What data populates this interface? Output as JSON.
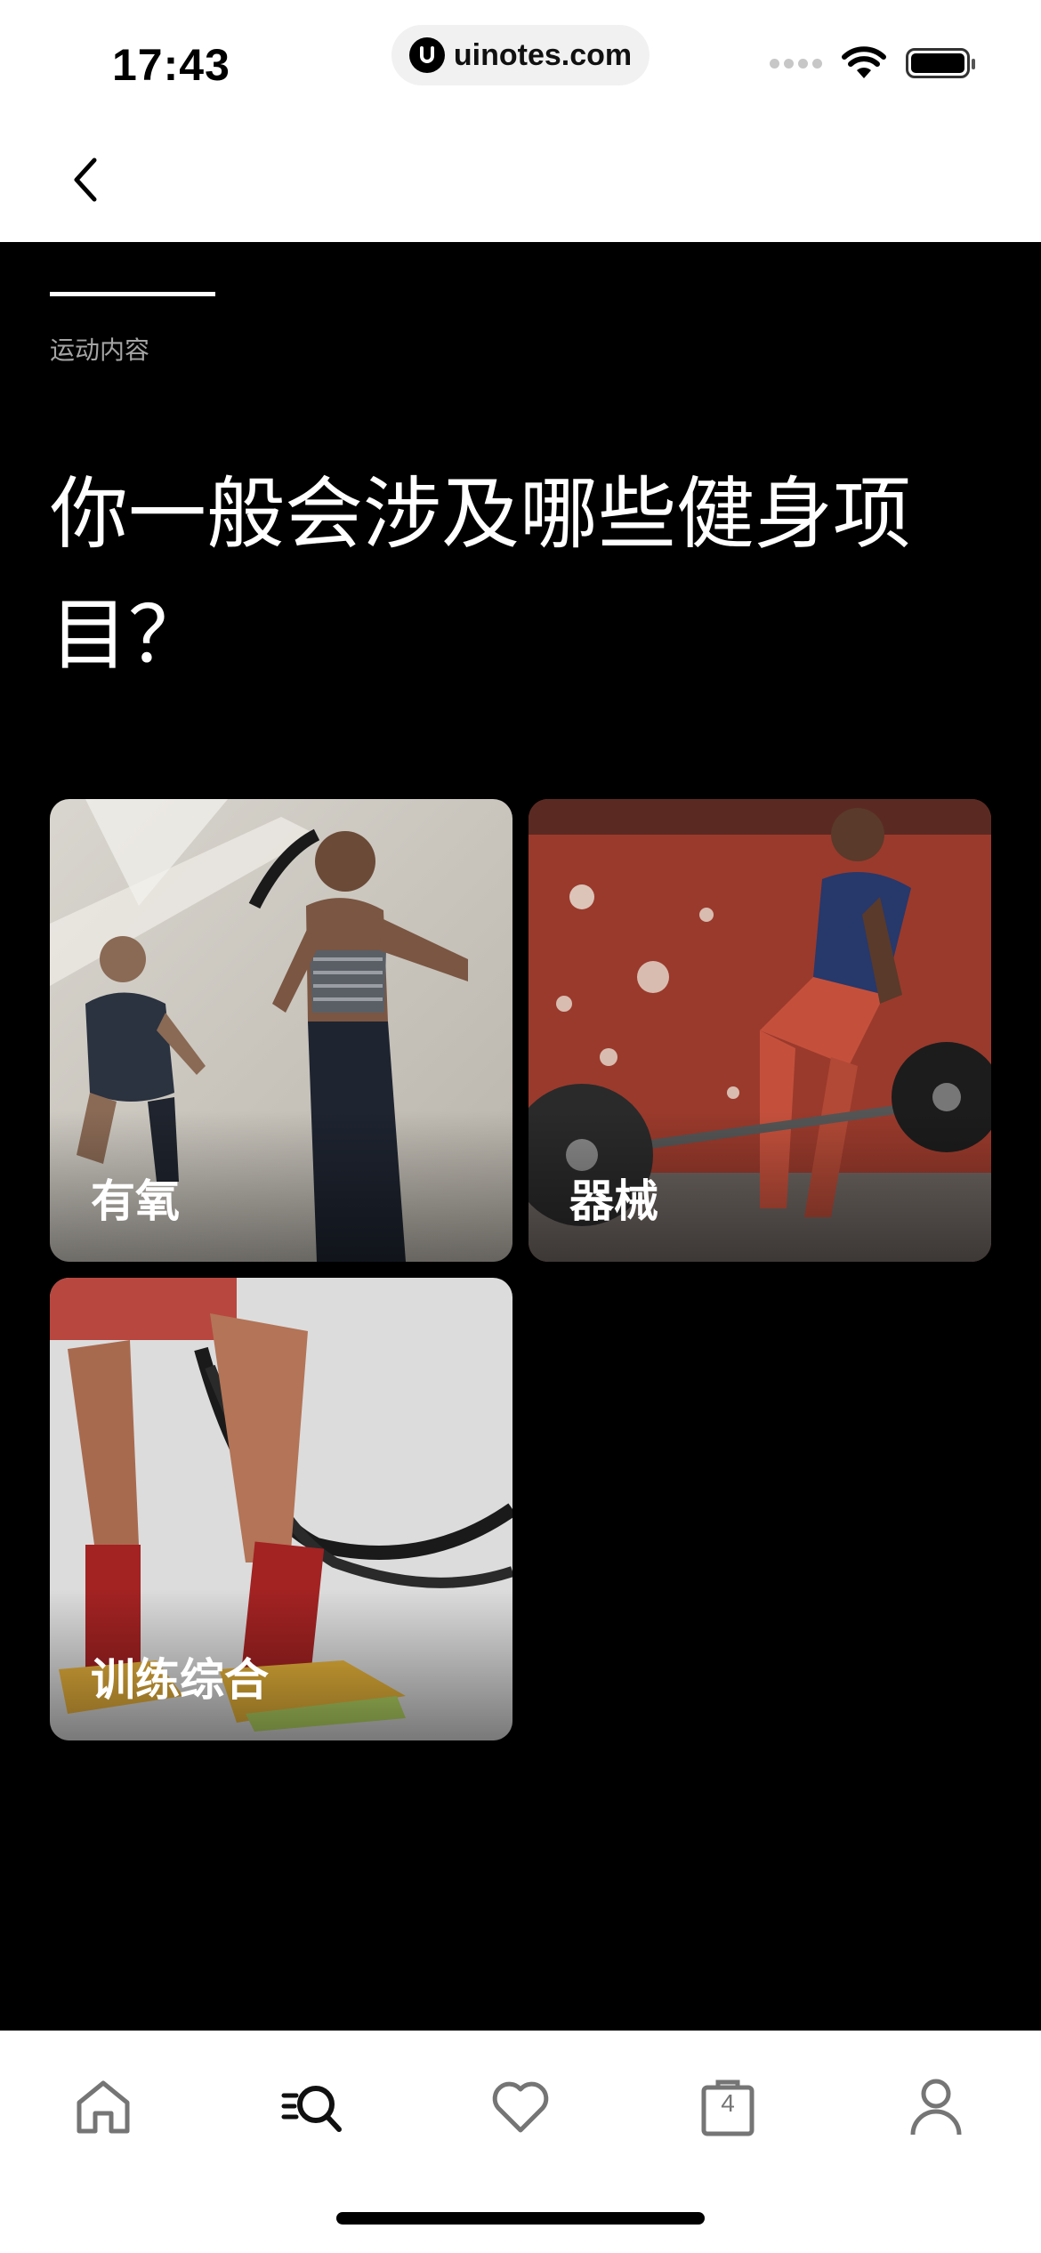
{
  "status_bar": {
    "time": "17:43",
    "url": "uinotes.com"
  },
  "nav": {
    "back_icon": "chevron-left-icon"
  },
  "survey": {
    "section_label": "运动内容",
    "question": "你一般会涉及哪些健身项目？",
    "options": [
      {
        "label": "有氧"
      },
      {
        "label": "器械"
      },
      {
        "label": "训练综合"
      }
    ]
  },
  "tab_bar": {
    "items": [
      {
        "icon": "home-icon"
      },
      {
        "icon": "search-list-icon"
      },
      {
        "icon": "heart-icon"
      },
      {
        "icon": "bag-icon",
        "badge": "4"
      },
      {
        "icon": "profile-icon"
      }
    ]
  },
  "colors": {
    "content_background": "#000000",
    "text_primary": "#ffffff",
    "text_secondary": "#a4a4a4",
    "icon_gray": "#757575"
  }
}
